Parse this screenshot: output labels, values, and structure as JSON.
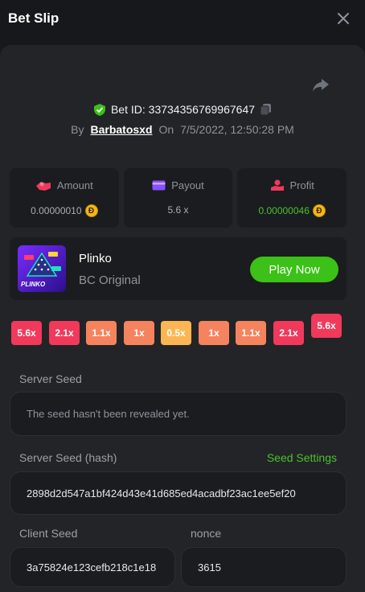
{
  "header": {
    "title": "Bet Slip"
  },
  "bet": {
    "id": "Bet ID: 33734356769967647",
    "by_label": "By",
    "user": "Barbatosxd",
    "on_label": "On",
    "datetime": "7/5/2022, 12:50:28 PM"
  },
  "stats": {
    "amount": {
      "label": "Amount",
      "value": "0.00000010"
    },
    "payout": {
      "label": "Payout",
      "value": "5.6 x"
    },
    "profit": {
      "label": "Profit",
      "value": "0.00000046"
    }
  },
  "coin_symbol": "Ð",
  "game": {
    "name": "Plinko",
    "sub": "BC Original",
    "play_label": "Play Now",
    "thumb_text": "PLINKO"
  },
  "multipliers": [
    "5.6x",
    "2.1x",
    "1.1x",
    "1x",
    "0.5x",
    "1x",
    "1.1x",
    "2.1x",
    "5.6x"
  ],
  "multiplier_hit_index": 8,
  "server_seed": {
    "label": "Server Seed",
    "value": "The seed hasn't been revealed yet."
  },
  "server_seed_hash": {
    "label": "Server Seed (hash)",
    "settings_label": "Seed Settings",
    "value": "2898d2d547a1bf424d43e41d685ed4acadbf23ac1ee5ef20"
  },
  "client_seed": {
    "label": "Client Seed",
    "value": "3a75824e123cefb218c1e18"
  },
  "nonce": {
    "label": "nonce",
    "value": "3615"
  },
  "colors": {
    "accent_green": "#3bc117",
    "red": "#f0395b",
    "orange": "#f5835e",
    "yellow": "#fbb653"
  }
}
